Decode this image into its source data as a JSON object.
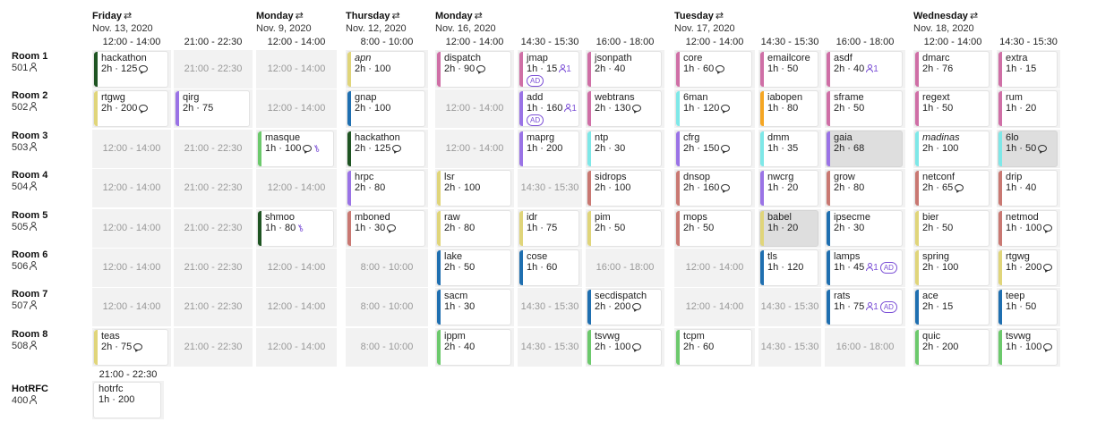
{
  "days": [
    {
      "name": "Friday",
      "date": "Nov. 13, 2020"
    },
    {
      "name": "Monday",
      "date": "Nov. 9, 2020"
    },
    {
      "name": "Thursday",
      "date": "Nov. 12, 2020"
    },
    {
      "name": "Monday",
      "date": "Nov. 16, 2020"
    },
    {
      "name": "Tuesday",
      "date": "Nov. 17, 2020"
    },
    {
      "name": "Wednesday",
      "date": "Nov. 18, 2020"
    }
  ],
  "columns": [
    "12:00 - 14:00",
    "21:00 - 22:30",
    "12:00 - 14:00",
    "8:00 - 10:00",
    "12:00 - 14:00",
    "14:30 - 15:30",
    "16:00 - 18:00",
    "12:00 - 14:00",
    "14:30 - 15:30",
    "16:00 - 18:00",
    "12:00 - 14:00",
    "14:30 - 15:30"
  ],
  "rooms": [
    {
      "name": "Room 1",
      "capacity": "501"
    },
    {
      "name": "Room 2",
      "capacity": "502"
    },
    {
      "name": "Room 3",
      "capacity": "503"
    },
    {
      "name": "Room 4",
      "capacity": "504"
    },
    {
      "name": "Room 5",
      "capacity": "505"
    },
    {
      "name": "Room 6",
      "capacity": "506"
    },
    {
      "name": "Room 7",
      "capacity": "507"
    },
    {
      "name": "Room 8",
      "capacity": "508"
    }
  ],
  "hotrfc": {
    "name": "HotRFC",
    "capacity": "400",
    "slot": "21:00 - 22:30",
    "session": {
      "name": "hotrfc",
      "info": "1h · 200",
      "color": "#ffffff"
    }
  },
  "grid": [
    [
      {
        "name": "hackathon",
        "info": "2h · 125",
        "color": "#1e5422",
        "chat": true
      },
      {
        "empty": "21:00 - 22:30"
      },
      {
        "empty": "12:00 - 14:00"
      },
      {
        "name": "apn",
        "info": "2h · 100",
        "color": "#e0d57a",
        "italic": true
      },
      {
        "name": "dispatch",
        "info": "2h · 90",
        "color": "#cf6fa6",
        "chat": true
      },
      {
        "name": "jmap",
        "info": "1h · 15",
        "color": "#cf6fa6",
        "people": "1",
        "ad": "AD",
        "adBlock": true
      },
      {
        "name": "jsonpath",
        "info": "2h · 40",
        "color": "#cf6fa6"
      },
      {
        "name": "core",
        "info": "1h · 60",
        "color": "#cf6fa6",
        "chat": true
      },
      {
        "name": "emailcore",
        "info": "1h · 50",
        "color": "#cf6fa6"
      },
      {
        "name": "asdf",
        "info": "2h · 40",
        "color": "#cf6fa6",
        "people": "1"
      },
      {
        "name": "dmarc",
        "info": "2h · 76",
        "color": "#cf6fa6"
      },
      {
        "name": "extra",
        "info": "1h · 15",
        "color": "#cf6fa6"
      }
    ],
    [
      {
        "name": "rtgwg",
        "info": "2h · 200",
        "color": "#e0d57a",
        "chat": true
      },
      {
        "name": "qirg",
        "info": "2h · 75",
        "color": "#9a73e6"
      },
      {
        "empty": "12:00 - 14:00"
      },
      {
        "name": "gnap",
        "info": "2h · 100",
        "color": "#1f6fb0"
      },
      {
        "empty": "12:00 - 14:00"
      },
      {
        "name": "add",
        "info": "1h · 160",
        "color": "#9a73e6",
        "people": "1",
        "ad": "AD",
        "adBlock": true
      },
      {
        "name": "webtrans",
        "info": "2h · 130",
        "color": "#cf6fa6",
        "chat": true
      },
      {
        "name": "6man",
        "info": "1h · 120",
        "color": "#7ee8e8",
        "chat": true
      },
      {
        "name": "iabopen",
        "info": "1h · 80",
        "color": "#f5a623"
      },
      {
        "name": "sframe",
        "info": "2h · 50",
        "color": "#cf6fa6"
      },
      {
        "name": "regext",
        "info": "1h · 50",
        "color": "#cf6fa6"
      },
      {
        "name": "rum",
        "info": "1h · 20",
        "color": "#cf6fa6"
      }
    ],
    [
      {
        "empty": "12:00 - 14:00"
      },
      {
        "empty": "21:00 - 22:30"
      },
      {
        "name": "masque",
        "info": "1h · 100",
        "color": "#6cc96c",
        "chat": true,
        "key": true
      },
      {
        "name": "hackathon",
        "info": "2h · 125",
        "color": "#1e5422",
        "chat": true
      },
      {
        "empty": "12:00 - 14:00"
      },
      {
        "name": "maprg",
        "info": "1h · 200",
        "color": "#9a73e6"
      },
      {
        "name": "ntp",
        "info": "2h · 30",
        "color": "#7ee8e8"
      },
      {
        "name": "cfrg",
        "info": "2h · 150",
        "color": "#9a73e6",
        "chat": true
      },
      {
        "name": "dmm",
        "info": "1h · 35",
        "color": "#7ee8e8"
      },
      {
        "name": "gaia",
        "info": "2h · 68",
        "color": "#9a73e6",
        "grey": true
      },
      {
        "name": "madinas",
        "info": "2h · 100",
        "color": "#7ee8e8",
        "italic": true
      },
      {
        "name": "6lo",
        "info": "1h · 50",
        "color": "#7ee8e8",
        "chat": true,
        "grey": true
      }
    ],
    [
      {
        "empty": "12:00 - 14:00"
      },
      {
        "empty": "21:00 - 22:30"
      },
      {
        "empty": "12:00 - 14:00"
      },
      {
        "name": "hrpc",
        "info": "2h · 80",
        "color": "#9a73e6"
      },
      {
        "name": "lsr",
        "info": "2h · 100",
        "color": "#e0d57a"
      },
      {
        "empty": "14:30 - 15:30"
      },
      {
        "name": "sidrops",
        "info": "2h · 100",
        "color": "#c97872"
      },
      {
        "name": "dnsop",
        "info": "2h · 160",
        "color": "#c97872",
        "chat": true
      },
      {
        "name": "nwcrg",
        "info": "1h · 20",
        "color": "#9a73e6"
      },
      {
        "name": "grow",
        "info": "2h · 80",
        "color": "#c97872"
      },
      {
        "name": "netconf",
        "info": "2h · 65",
        "color": "#c97872",
        "chat": true
      },
      {
        "name": "drip",
        "info": "1h · 40",
        "color": "#c97872"
      }
    ],
    [
      {
        "empty": "12:00 - 14:00"
      },
      {
        "empty": "21:00 - 22:30"
      },
      {
        "name": "shmoo",
        "info": "1h · 80",
        "color": "#1e5422",
        "key": true
      },
      {
        "name": "mboned",
        "info": "1h · 30",
        "color": "#c97872",
        "chat": true
      },
      {
        "name": "raw",
        "info": "2h · 80",
        "color": "#e0d57a"
      },
      {
        "name": "idr",
        "info": "1h · 75",
        "color": "#e0d57a"
      },
      {
        "name": "pim",
        "info": "2h · 50",
        "color": "#e0d57a"
      },
      {
        "name": "mops",
        "info": "2h · 50",
        "color": "#c97872"
      },
      {
        "name": "babel",
        "info": "1h · 20",
        "color": "#e0d57a",
        "grey": true
      },
      {
        "name": "ipsecme",
        "info": "2h · 30",
        "color": "#1f6fb0"
      },
      {
        "name": "bier",
        "info": "2h · 50",
        "color": "#e0d57a"
      },
      {
        "name": "netmod",
        "info": "1h · 100",
        "color": "#c97872",
        "chat": true
      }
    ],
    [
      {
        "empty": "12:00 - 14:00"
      },
      {
        "empty": "21:00 - 22:30"
      },
      {
        "empty": "12:00 - 14:00"
      },
      {
        "empty": "8:00 - 10:00"
      },
      {
        "name": "lake",
        "info": "2h · 50",
        "color": "#1f6fb0"
      },
      {
        "name": "cose",
        "info": "1h · 60",
        "color": "#1f6fb0"
      },
      {
        "empty": "16:00 - 18:00"
      },
      {
        "empty": "12:00 - 14:00"
      },
      {
        "name": "tls",
        "info": "1h · 120",
        "color": "#1f6fb0"
      },
      {
        "name": "lamps",
        "info": "1h · 45",
        "color": "#1f6fb0",
        "people": "1",
        "ad": "AD"
      },
      {
        "name": "spring",
        "info": "2h · 100",
        "color": "#e0d57a"
      },
      {
        "name": "rtgwg",
        "info": "1h · 200",
        "color": "#e0d57a",
        "chat": true
      }
    ],
    [
      {
        "empty": "12:00 - 14:00"
      },
      {
        "empty": "21:00 - 22:30"
      },
      {
        "empty": "12:00 - 14:00"
      },
      {
        "empty": "8:00 - 10:00"
      },
      {
        "name": "sacm",
        "info": "1h · 30",
        "color": "#1f6fb0"
      },
      {
        "empty": "14:30 - 15:30"
      },
      {
        "name": "secdispatch",
        "info": "2h · 200",
        "color": "#1f6fb0",
        "chat": true
      },
      {
        "empty": "12:00 - 14:00"
      },
      {
        "empty": "14:30 - 15:30"
      },
      {
        "name": "rats",
        "info": "1h · 75",
        "color": "#1f6fb0",
        "people": "1",
        "ad": "AD"
      },
      {
        "name": "ace",
        "info": "2h · 15",
        "color": "#1f6fb0"
      },
      {
        "name": "teep",
        "info": "1h · 50",
        "color": "#1f6fb0"
      }
    ],
    [
      {
        "name": "teas",
        "info": "2h · 75",
        "color": "#e0d57a",
        "chat": true
      },
      {
        "empty": "21:00 - 22:30"
      },
      {
        "empty": "12:00 - 14:00"
      },
      {
        "empty": "8:00 - 10:00"
      },
      {
        "name": "ippm",
        "info": "2h · 40",
        "color": "#6cc96c"
      },
      {
        "empty": "14:30 - 15:30"
      },
      {
        "name": "tsvwg",
        "info": "2h · 100",
        "color": "#6cc96c",
        "chat": true
      },
      {
        "name": "tcpm",
        "info": "2h · 60",
        "color": "#6cc96c"
      },
      {
        "empty": "14:30 - 15:30"
      },
      {
        "empty": "16:00 - 18:00"
      },
      {
        "name": "quic",
        "info": "2h · 200",
        "color": "#6cc96c"
      },
      {
        "name": "tsvwg",
        "info": "1h · 100",
        "color": "#6cc96c",
        "chat": true
      }
    ]
  ]
}
